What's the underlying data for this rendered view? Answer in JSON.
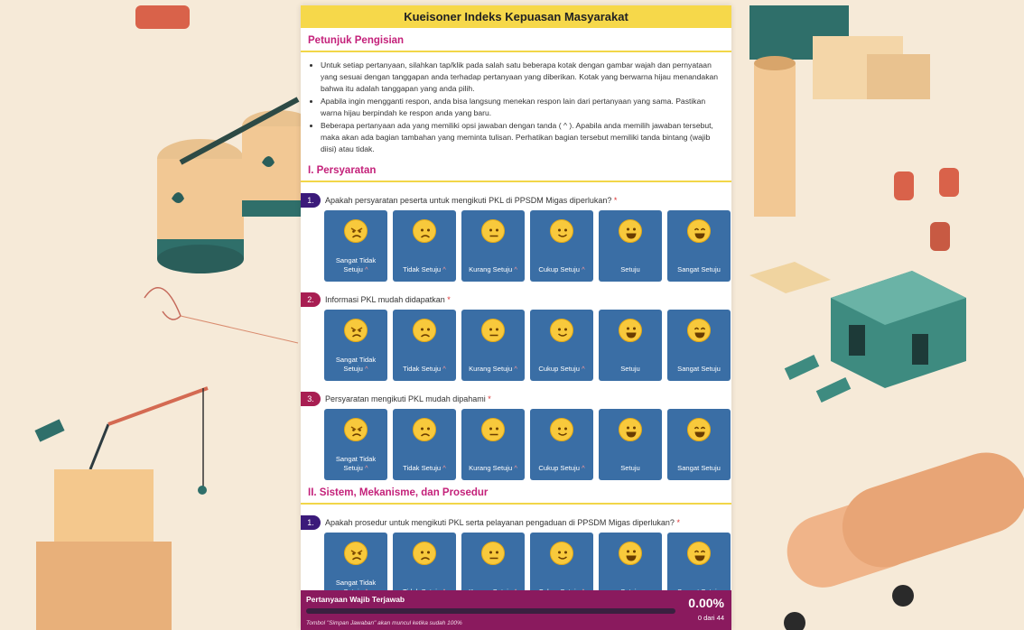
{
  "header": {
    "title": "Kueisoner Indeks Kepuasan Masyarakat"
  },
  "instructions": {
    "title": "Petunjuk Pengisian",
    "items": [
      "Untuk setiap pertanyaan, silahkan tap/klik pada salah satu beberapa kotak dengan gambar wajah dan pernyataan yang sesuai dengan tanggapan anda terhadap pertanyaan yang diberikan. Kotak yang berwarna hijau menandakan bahwa itu adalah tanggapan yang anda pilih.",
      "Apabila ingin mengganti respon, anda bisa langsung menekan respon lain dari pertanyaan yang sama. Pastikan warna hijau berpindah ke respon anda yang baru.",
      "Beberapa pertanyaan ada yang memiliki opsi jawaban dengan tanda ( ^ ). Apabila anda memilih jawaban tersebut, maka akan ada bagian tambahan yang meminta tulisan. Perhatikan bagian tersebut memiliki tanda bintang (wajib diisi) atau tidak."
    ]
  },
  "sections": [
    {
      "title": "I. Persyaratan",
      "questions": [
        {
          "number": "1.",
          "text": "Apakah persyaratan peserta untuk mengikuti PKL di PPSDM Migas diperlukan?",
          "required": "*"
        },
        {
          "number": "2.",
          "text": "Informasi PKL mudah didapatkan",
          "required": "*"
        },
        {
          "number": "3.",
          "text": "Persyaratan mengikuti PKL mudah dipahami",
          "required": "*"
        }
      ]
    },
    {
      "title": "II. Sistem, Mekanisme, dan Prosedur",
      "questions": [
        {
          "number": "1.",
          "text": "Apakah prosedur untuk mengikuti PKL serta pelayanan pengaduan di PPSDM Migas diperlukan?",
          "required": "*"
        }
      ]
    }
  ],
  "options": [
    {
      "label": "Sangat Tidak Setuju",
      "marker": "^",
      "face": "very-angry-face-icon"
    },
    {
      "label": "Tidak Setuju",
      "marker": "^",
      "face": "sad-face-icon"
    },
    {
      "label": "Kurang Setuju",
      "marker": "^",
      "face": "neutral-face-icon"
    },
    {
      "label": "Cukup Setuju",
      "marker": "^",
      "face": "slight-smile-face-icon"
    },
    {
      "label": "Setuju",
      "marker": "",
      "face": "smile-face-icon"
    },
    {
      "label": "Sangat Setuju",
      "marker": "",
      "face": "big-smile-face-icon"
    }
  ],
  "progress": {
    "title": "Pertanyaan Wajib Terjawab",
    "percent": "0.00%",
    "count": "0 dari 44",
    "value": 0,
    "note": "Tombol \"Simpan Jawaban\" akan muncul ketika sudah 100%"
  },
  "colors": {
    "header_bg": "#f6d84a",
    "section_title": "#c4217a",
    "option_bg": "#3a6ea5",
    "progress_bg": "#8a1a5e",
    "question_badge": "#3b1a7a"
  }
}
